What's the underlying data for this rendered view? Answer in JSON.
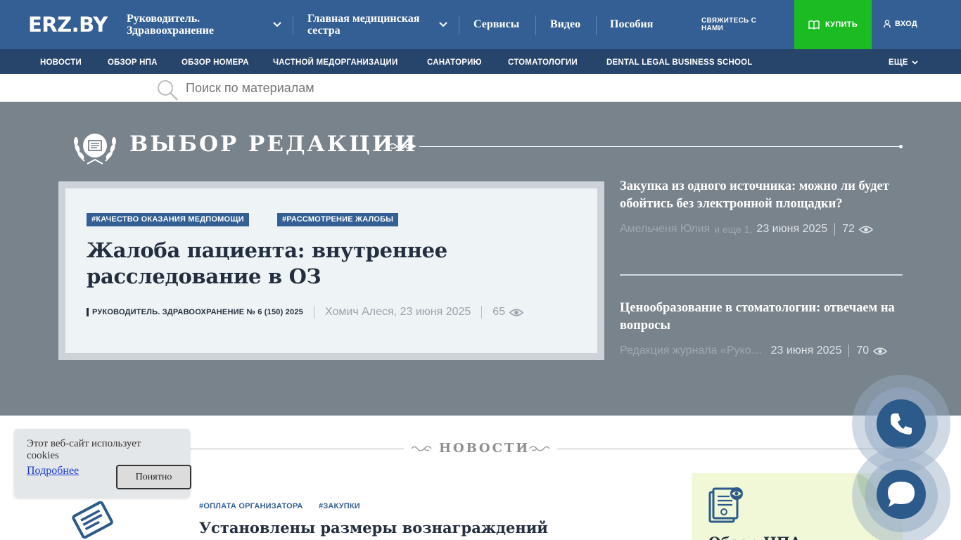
{
  "header": {
    "logo": "ERZ.BY",
    "nav_dropdowns": [
      {
        "line1": "Руководитель.",
        "line2": "Здравоохранение"
      },
      {
        "line1": "Главная медицинская",
        "line2": "сестра"
      }
    ],
    "nav_links": [
      "Сервисы",
      "Видео",
      "Пособия"
    ],
    "contact_line1": "СВЯЖИТЕСЬ С",
    "contact_line2": "НАМИ",
    "buy_label": "КУПИТЬ",
    "login_label": "ВХОД",
    "colors": {
      "header_bg": "#335f94",
      "subnav_bg": "#27446b",
      "buy_bg": "#1bbb22"
    }
  },
  "subnav": {
    "items": [
      "НОВОСТИ",
      "ОБЗОР НПА",
      "ОБЗОР НОМЕРА",
      "ЧАСТНОЙ МЕДОРГАНИЗАЦИИ",
      "САНАТОРИЮ",
      "СТОМАТОЛОГИИ",
      "DENTAL LEGAL BUSINESS SCHOOL"
    ],
    "more_label": "ЕЩЕ"
  },
  "search": {
    "placeholder": "Поиск по материалам"
  },
  "editor_choice": {
    "title": "ВЫБОР РЕДАКЦИИ",
    "featured": {
      "tags": [
        "#КАЧЕСТВО ОКАЗАНИЯ МЕДПОМОЩИ",
        "#РАССМОТРЕНИЕ ЖАЛОБЫ"
      ],
      "title": "Жалоба пациента: внутреннее расследование в ОЗ",
      "issue": "РУКОВОДИТЕЛЬ. ЗДРАВООХРАНЕНИЕ № 6 (150) 2025",
      "author_date": "Хомич Алеся, 23 июня 2025",
      "views": "65"
    },
    "side": [
      {
        "title": "Закупка из одного источника: можно ли будет обойтись без электронной площадки?",
        "author": "Амельченя Юлия",
        "more": "и еще 1,",
        "date": "23 июня 2025",
        "views": "72"
      },
      {
        "title": "Ценообразование в стоматологии: отвечаем на вопросы",
        "author": "Редакция журнала «Руко…",
        "more": "",
        "date": "23 июня 2025",
        "views": "70"
      }
    ]
  },
  "news": {
    "title": "НОВОСТИ",
    "tags": [
      "#ОПЛАТА ОРГАНИЗАТОРА",
      "#ЗАКУПКИ"
    ],
    "headline": "Установлены размеры вознаграждений",
    "npa_title": "Обзор НПА"
  },
  "cookie": {
    "text": "Этот веб-сайт использует cookies",
    "link": "Подробнее",
    "button": "Понятно"
  }
}
